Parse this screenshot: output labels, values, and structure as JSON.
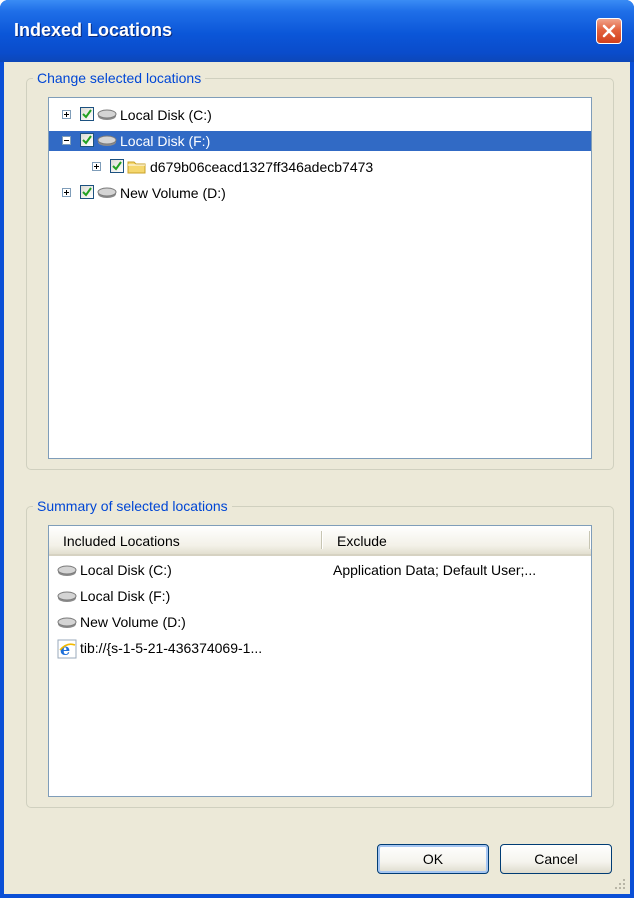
{
  "window": {
    "title": "Indexed Locations",
    "close_icon": "close-icon"
  },
  "change_group": {
    "legend": "Change selected locations",
    "tree": [
      {
        "label": "Local Disk (C:)",
        "level": 0,
        "expander": "plus",
        "checked": true,
        "icon": "drive-icon",
        "selected": false
      },
      {
        "label": "Local Disk (F:)",
        "level": 0,
        "expander": "minus",
        "checked": true,
        "icon": "drive-icon",
        "selected": true
      },
      {
        "label": "d679b06ceacd1327ff346adecb7473",
        "level": 1,
        "expander": "plus",
        "checked": true,
        "icon": "folder-icon",
        "selected": false
      },
      {
        "label": "New Volume (D:)",
        "level": 0,
        "expander": "plus",
        "checked": true,
        "icon": "drive-icon",
        "selected": false
      }
    ]
  },
  "summary_group": {
    "legend": "Summary of selected locations",
    "columns": {
      "included": "Included Locations",
      "exclude": "Exclude"
    },
    "rows": [
      {
        "icon": "drive-icon",
        "included": "Local Disk (C:)",
        "exclude": "Application Data; Default User;..."
      },
      {
        "icon": "drive-icon",
        "included": "Local Disk (F:)",
        "exclude": ""
      },
      {
        "icon": "drive-icon",
        "included": "New Volume (D:)",
        "exclude": ""
      },
      {
        "icon": "ie-icon",
        "included": "tib://{s-1-5-21-436374069-1...",
        "exclude": ""
      }
    ]
  },
  "buttons": {
    "ok": "OK",
    "cancel": "Cancel"
  },
  "colors": {
    "title_bar": "#0a4ccb",
    "selection": "#316ac5",
    "group_legend": "#0046d5",
    "dialog_face": "#ece9d8"
  }
}
